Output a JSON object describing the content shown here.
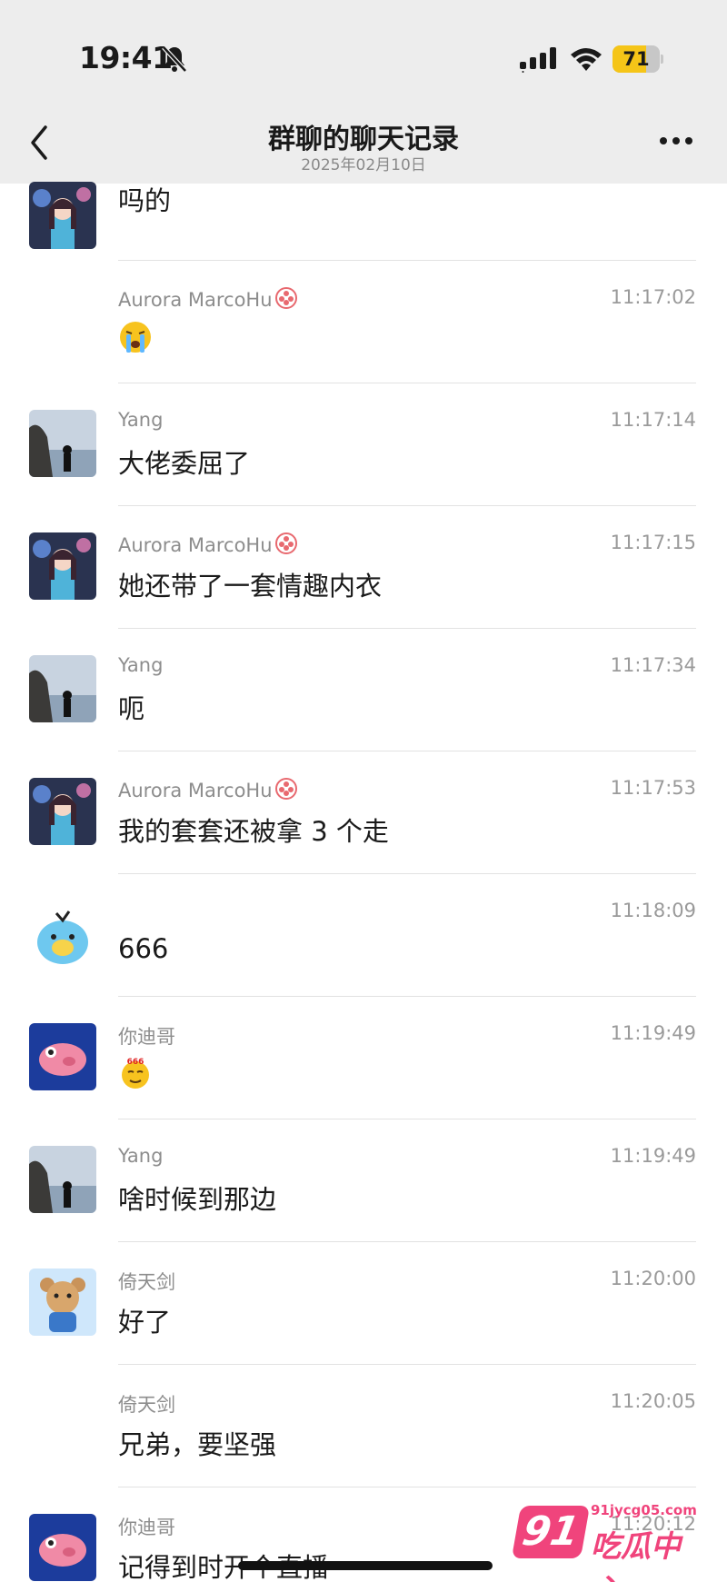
{
  "status_bar": {
    "time": "19:41",
    "battery": "71",
    "battery_level": 0.71
  },
  "header": {
    "title": "群聊的聊天记录",
    "date": "2025年02月10日"
  },
  "messages": [
    {
      "name": "",
      "time": "",
      "text": "吗的"
    },
    {
      "name": "Aurora MarcoHu",
      "time": "11:17:02",
      "emoji": "crying-face"
    },
    {
      "name": "Yang",
      "time": "11:17:14",
      "text": "大佬委屈了"
    },
    {
      "name": "Aurora MarcoHu",
      "time": "11:17:15",
      "text": "她还带了一套情趣内衣"
    },
    {
      "name": "Yang",
      "time": "11:17:34",
      "text": "呃"
    },
    {
      "name": "Aurora MarcoHu",
      "time": "11:17:53",
      "text": "我的套套还被拿 3 个走"
    },
    {
      "name": "",
      "time": "11:18:09",
      "text": "666"
    },
    {
      "name": "你迪哥",
      "time": "11:19:49",
      "emoji": "666-face",
      "emoji_text": "666"
    },
    {
      "name": "Yang",
      "time": "11:19:49",
      "text": "啥时候到那边"
    },
    {
      "name": "倚天剑",
      "time": "11:20:00",
      "text": "好了"
    },
    {
      "name": "倚天剑",
      "time": "11:20:05",
      "text": "兄弟，要坚强"
    },
    {
      "name": "你迪哥",
      "time": "11:20:12",
      "text": "记得到时开个直播"
    }
  ],
  "watermark": {
    "logo": "91",
    "url": "91jycg05.com",
    "name": "吃瓜中心"
  },
  "colors": {
    "header_bg": "#ededed",
    "badge": "#e8696f",
    "watermark": "#f0447c"
  }
}
